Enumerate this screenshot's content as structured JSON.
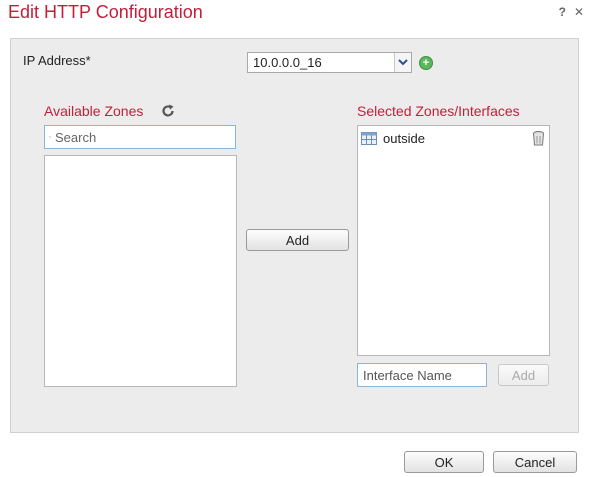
{
  "dialog": {
    "title": "Edit HTTP Configuration",
    "help": "?",
    "close": "✕"
  },
  "ip_address": {
    "label": "IP Address*",
    "value": "10.0.0.0_16"
  },
  "available_zones": {
    "title": "Available Zones",
    "search_placeholder": "Search",
    "items": []
  },
  "add_button": "Add",
  "selected": {
    "title": "Selected Zones/Interfaces",
    "items": [
      {
        "label": "outside"
      }
    ],
    "interface_placeholder": "Interface Name",
    "add_label": "Add"
  },
  "footer": {
    "ok": "OK",
    "cancel": "Cancel"
  },
  "colors": {
    "title_red": "#c41e3a",
    "add_green": "#5cb85c",
    "focus_blue": "#8cb4d6"
  }
}
